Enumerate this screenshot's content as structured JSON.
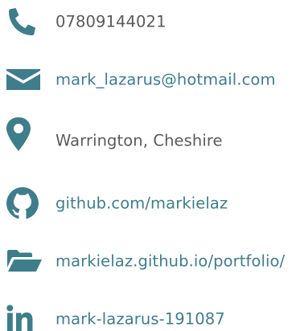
{
  "colors": {
    "icon": "#3f7d8b",
    "text": "#5a5a5a",
    "link": "#3f7d8b",
    "background": "#ffffff"
  },
  "contacts": [
    {
      "icon": "phone-icon",
      "text": "07809144021",
      "is_link": false
    },
    {
      "icon": "envelope-icon",
      "text": "mark_lazarus@hotmail.com",
      "is_link": true
    },
    {
      "icon": "map-pin-icon",
      "text": "Warrington, Cheshire",
      "is_link": false
    },
    {
      "icon": "github-icon",
      "text": "github.com/markielaz",
      "is_link": true
    },
    {
      "icon": "folder-open-icon",
      "text": "markielaz.github.io/portfolio/",
      "is_link": true
    },
    {
      "icon": "linkedin-icon",
      "text": "mark-lazarus-191087",
      "is_link": true
    }
  ]
}
